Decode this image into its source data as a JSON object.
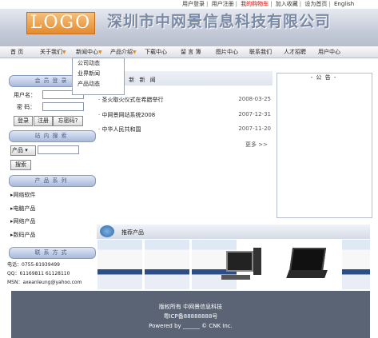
{
  "toplinks": [
    "用户登录",
    "用户注册",
    "我的购物车",
    "加入收藏",
    "设为首页",
    "English"
  ],
  "header": {
    "logo": "LOGO",
    "company": "深圳市中网景信息科技有限公司"
  },
  "nav": [
    "首 页",
    "关于我们",
    "新闻中心",
    "产品介绍",
    "下载中心",
    "留 言 簿",
    "图片中心",
    "联系我们",
    "人才招聘",
    "用户中心"
  ],
  "dropdown": [
    "公司动态",
    "业界新闻",
    "产品动态"
  ],
  "login": {
    "title": "会员登录",
    "user_label": "用户名：",
    "pass_label": "密  码：",
    "btn_login": "登录",
    "btn_register": "注册",
    "btn_forgot": "忘密码?"
  },
  "search": {
    "title": "站内搜索",
    "select_value": "产品",
    "btn": "搜索"
  },
  "products": {
    "title": "产品系列",
    "items": [
      "网络软件",
      "电脑产品",
      "网络产品",
      "数码产品"
    ]
  },
  "contact": {
    "title": "联系方式",
    "phone": "电话：0755-81939499",
    "qq": "QQ：61169811 61128110",
    "msn": "MSN：axeanleung@yahoo.com"
  },
  "news": {
    "title": "最 新 新 闻",
    "items": [
      {
        "title": "·  圣火取火仪式在希腊举行",
        "date": "2008-03-25"
      },
      {
        "title": "·  中网景网站系统2008",
        "date": "2007-12-31"
      },
      {
        "title": "·  中华人民共和国",
        "date": "2007-11-20"
      }
    ],
    "more": "更多 >>"
  },
  "notice": {
    "title": "- 公 告 -"
  },
  "recommend": {
    "title": "推荐产品"
  },
  "footer": {
    "line1": "版权所有  中网景信息科技",
    "line2": "粤ICP备88888888号",
    "line3": "Powered by  ______  © CNK Inc."
  },
  "colors": {
    "accent": "#e08a20",
    "nav_bg": "#e6e8ee",
    "head_blue": "#a9b9da",
    "footer": "#5b6475"
  }
}
